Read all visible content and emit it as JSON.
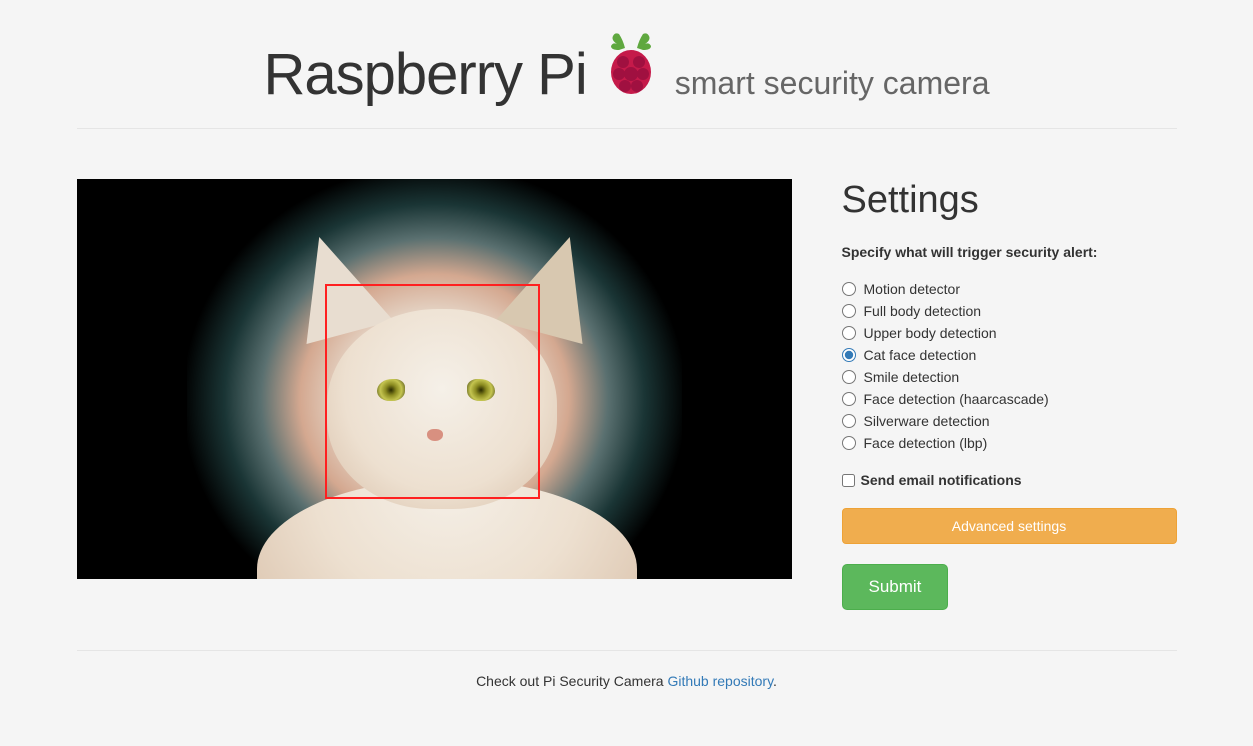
{
  "header": {
    "title_main": "Raspberry Pi",
    "title_sub": "smart security camera",
    "logo_icon": "raspberry-pi-logo"
  },
  "settings": {
    "title": "Settings",
    "prompt": "Specify what will trigger security alert:",
    "options": [
      {
        "label": "Motion detector",
        "selected": false
      },
      {
        "label": "Full body detection",
        "selected": false
      },
      {
        "label": "Upper body detection",
        "selected": false
      },
      {
        "label": "Cat face detection",
        "selected": true
      },
      {
        "label": "Smile detection",
        "selected": false
      },
      {
        "label": "Face detection (haarcascade)",
        "selected": false
      },
      {
        "label": "Silverware detection",
        "selected": false
      },
      {
        "label": "Face detection (lbp)",
        "selected": false
      }
    ],
    "email_checkbox": {
      "label": "Send email notifications",
      "checked": false
    },
    "advanced_button": "Advanced settings",
    "submit_button": "Submit"
  },
  "video": {
    "detection_box": {
      "visible": true,
      "subject": "cat-face"
    }
  },
  "footer": {
    "text_before": "Check out Pi Security Camera ",
    "link_text": "Github repository",
    "text_after": "."
  }
}
